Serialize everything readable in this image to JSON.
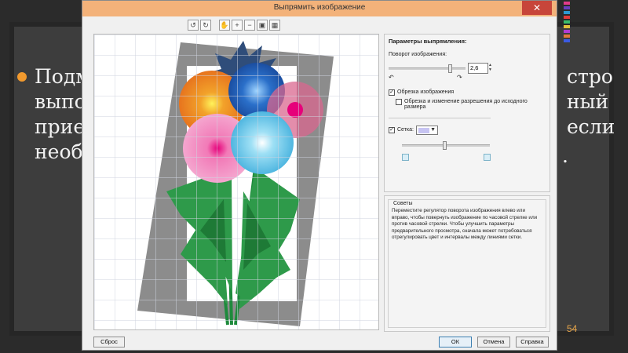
{
  "slide": {
    "left_text": [
      "Подм",
      "выпо",
      "прие",
      "необ"
    ],
    "right_text": [
      "стро",
      "ный",
      "если"
    ],
    "bottom_dot": ".",
    "page_number": "54"
  },
  "dialog": {
    "title": "Выпрямить изображение",
    "close_label": "✕",
    "toolbar": {
      "rotate_left": "↺",
      "rotate_right": "↻",
      "pan": "✋",
      "zoom_in": "+",
      "zoom_out": "−",
      "fit": "▣",
      "actual": "▦"
    },
    "params": {
      "title": "Параметры выпрямления:",
      "rotation_label": "Поворот изображения:",
      "rotation_value": "2,6",
      "crop_label": "Обрезка изображения",
      "crop_checked": true,
      "crop_resize_label": "Обрезка и изменение разрешения до исходного размера",
      "crop_resize_checked": false,
      "grid_label": "Сетка:",
      "grid_checked": true,
      "grid_color": "#c7c4f2"
    },
    "tips": {
      "title": "Советы",
      "text": "Переместите регулятор поворота изображения влево или вправо, чтобы повернуть изображение по часовой стрелке или против часовой стрелки. Чтобы улучшить параметры предварительного просмотра, сначала может потребоваться отрегулировать цвет и интервалы между линиями сетки."
    },
    "buttons": {
      "reset": "Сброс",
      "ok": "ОК",
      "cancel": "Отмена",
      "help": "Справка"
    }
  },
  "colors": {
    "titlebar": "#f3b27a",
    "close": "#c7453a",
    "bullet": "#f29a2e",
    "page_number": "#e8a64a"
  }
}
